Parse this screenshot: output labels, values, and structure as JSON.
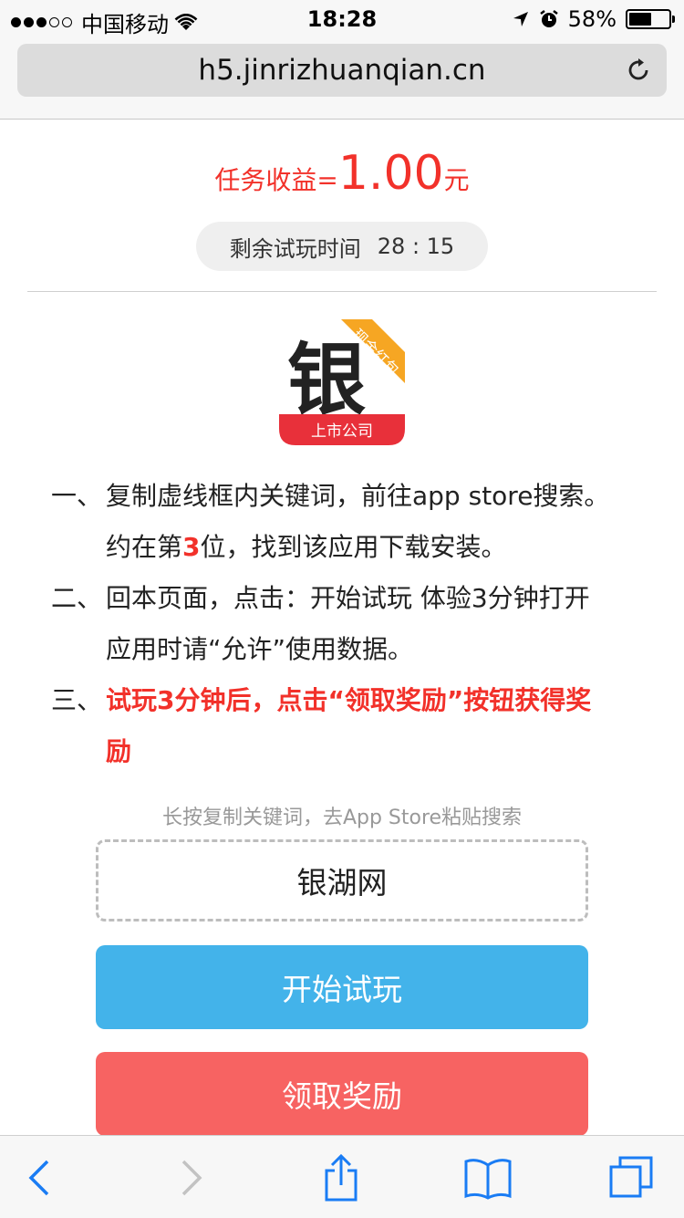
{
  "status_bar": {
    "carrier": "中国移动",
    "time": "18:28",
    "battery_percent": "58%",
    "battery_level": 0.58,
    "icons": [
      "signal-dots-icon",
      "wifi-icon",
      "location-arrow-icon",
      "alarm-icon",
      "battery-icon"
    ]
  },
  "browser": {
    "url": "h5.jinrizhuanqian.cn"
  },
  "reward": {
    "label": "任务收益=",
    "amount": "1.00",
    "unit": "元"
  },
  "timer": {
    "label": "剩余试玩时间",
    "value": "28 : 15"
  },
  "app_icon": {
    "glyph": "银",
    "ribbon": "现金红包",
    "tag": "上市公司"
  },
  "steps": [
    {
      "num": "一、",
      "line1": "复制虚线框内关键词，前往app store搜索。",
      "line2_before": "约在第",
      "line2_rank": "3",
      "line2_after": "位，找到该应用下载安装。"
    },
    {
      "num": "二、",
      "line1": "回本页面，点击：开始试玩 体验3分钟打开",
      "line2": "应用时请“允许”使用数据。"
    },
    {
      "num": "三、",
      "line1": "试玩3分钟后，点击“领取奖励”按钮获得奖",
      "line2": "励"
    }
  ],
  "hint": "长按复制关键词，去App Store粘贴搜索",
  "keyword": "银湖网",
  "buttons": {
    "start": "开始试玩",
    "claim": "领取奖励"
  },
  "colors": {
    "accent_red": "#f2312a",
    "start_button": "#43b3ea",
    "claim_button": "#f76362",
    "ios_blue": "#1a7cf4"
  }
}
